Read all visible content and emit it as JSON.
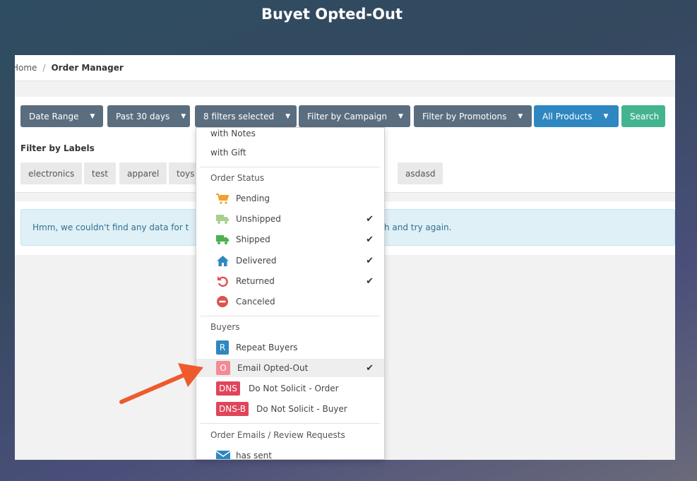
{
  "title": "Buyet Opted-Out",
  "breadcrumb": {
    "home": "Home",
    "separator": "/",
    "current": "Order Manager"
  },
  "filters": {
    "date_range": "Date Range",
    "period": "Past 30 days",
    "selected": "8 filters selected",
    "campaign": "Filter by Campaign",
    "promotions": "Filter by Promotions",
    "products": "All Products",
    "search": "Search",
    "caret": "▼"
  },
  "labels": {
    "title": "Filter by Labels",
    "tags": [
      "electronics",
      "test",
      "apparel",
      "toys",
      "asdasd"
    ]
  },
  "alert": {
    "lead": "Hmm, we couldn't find any data for t",
    "tail": "h and try again."
  },
  "dropdown": {
    "notes": "with Notes",
    "gift": "with Gift",
    "order_status_header": "Order Status",
    "pending": "Pending",
    "unshipped": "Unshipped",
    "shipped": "Shipped",
    "delivered": "Delivered",
    "returned": "Returned",
    "canceled": "Canceled",
    "buyers_header": "Buyers",
    "repeat_badge": "R",
    "repeat": "Repeat Buyers",
    "optout_badge": "O",
    "optout": "Email Opted-Out",
    "dns_badge": "DNS",
    "dns_order": "Do Not Solicit - Order",
    "dnsb_badge": "DNS-B",
    "dns_buyer": "Do Not Solicit - Buyer",
    "emails_header": "Order Emails / Review Requests",
    "has_sent": "has sent",
    "check": "✔"
  },
  "colors": {
    "pending": "#f0a02e",
    "unshipped": "#a8d08d",
    "shipped": "#4caf50",
    "delivered": "#2e87c1",
    "returned": "#e05050",
    "canceled": "#d9534f",
    "repeat_badge": "#2e87c1",
    "optout_badge": "#f28b95",
    "dns_badge": "#e0455a",
    "arrow": "#ee5a2e"
  },
  "icons": {
    "pending": "cart-icon",
    "unshipped": "truck-icon",
    "shipped": "truck-icon",
    "delivered": "home-icon",
    "returned": "undo-icon",
    "canceled": "minus-circle-icon",
    "has_sent": "envelope-icon"
  }
}
